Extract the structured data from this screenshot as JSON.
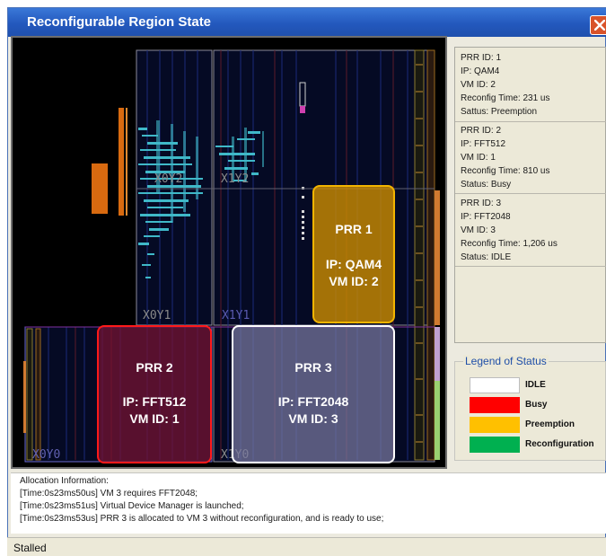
{
  "window": {
    "title": "Reconfigurable Region State",
    "close_glyph": "close-icon"
  },
  "fpga_view": {
    "clock_regions": [
      "X0Y2",
      "X1Y2",
      "X0Y1",
      "X1Y1",
      "X0Y0",
      "X1Y0"
    ],
    "regions": [
      {
        "id": "PRR 1",
        "ip": "IP: QAM4",
        "vm": "VM ID: 2",
        "status": "Preemption",
        "color": "#f2b400"
      },
      {
        "id": "PRR 2",
        "ip": "IP: FFT512",
        "vm": "VM ID: 1",
        "status": "Busy",
        "color": "#ff1a1a"
      },
      {
        "id": "PRR 3",
        "ip": "IP: FFT2048",
        "vm": "VM ID: 3",
        "status": "IDLE",
        "color": "#ffffff"
      }
    ]
  },
  "prr_info": [
    {
      "id": "PRR ID: 1",
      "ip": "IP: QAM4",
      "vm": "VM ID: 2",
      "reconfig": "Reconfig Time: 231 us",
      "status": "Sattus: Preemption"
    },
    {
      "id": "PRR ID: 2",
      "ip": "IP: FFT512",
      "vm": "VM ID: 1",
      "reconfig": "Reconfig Time: 810 us",
      "status": "Status: Busy"
    },
    {
      "id": "PRR ID: 3",
      "ip": "IP: FFT2048",
      "vm": "VM ID: 3",
      "reconfig": "Reconfig Time: 1,206 us",
      "status": "Status: IDLE"
    }
  ],
  "legend": {
    "title": "Legend of Status",
    "items": [
      {
        "label": "IDLE",
        "color": "#ffffff"
      },
      {
        "label": "Busy",
        "color": "#ff0000"
      },
      {
        "label": "Preemption",
        "color": "#ffc000"
      },
      {
        "label": "Reconfiguration",
        "color": "#00b050"
      }
    ]
  },
  "allocation": {
    "heading": "Allocation Information:",
    "lines": [
      "[Time:0s23ms50us] VM 3 requires FFT2048;",
      "[Time:0s23ms51us] Virtual Device Manager is launched;",
      "[Time:0s23ms53us] PRR 3 is allocated to VM 3 without reconfiguration, and is ready to use;"
    ]
  },
  "status_bar": {
    "text": "Stalled"
  }
}
